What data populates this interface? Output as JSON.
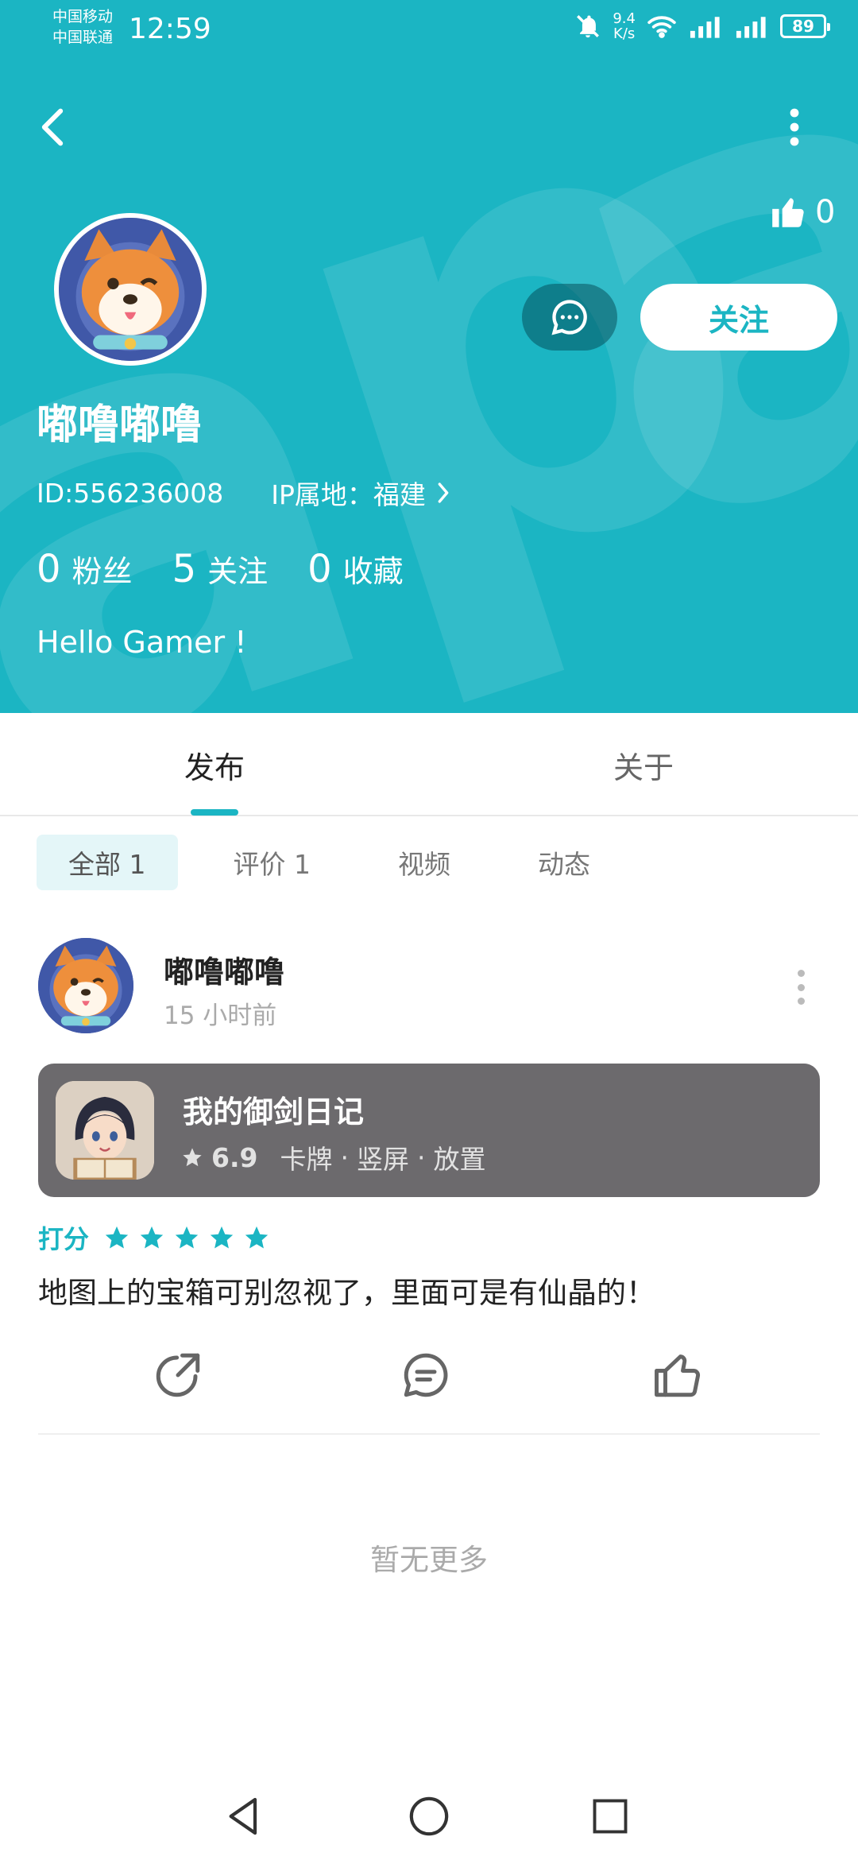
{
  "status_bar": {
    "carrier1": "中国移动",
    "carrier2": "中国联通",
    "time": "12:59",
    "net_speed_value": "9.4",
    "net_speed_unit": "K/s",
    "battery": "89"
  },
  "header": {
    "likes_count": "0",
    "follow_label": "关注",
    "username": "嘟噜嘟噜",
    "user_id": "ID:556236008",
    "ip_location": "IP属地：福建",
    "stats": [
      {
        "num": "0",
        "label": "粉丝"
      },
      {
        "num": "5",
        "label": "关注"
      },
      {
        "num": "0",
        "label": "收藏"
      }
    ],
    "bio": "Hello Gamer !"
  },
  "tabs": [
    {
      "label": "发布"
    },
    {
      "label": "关于"
    }
  ],
  "filters": [
    {
      "label": "全部 1"
    },
    {
      "label": "评价 1"
    },
    {
      "label": "视频"
    },
    {
      "label": "动态"
    }
  ],
  "post": {
    "author": "嘟噜嘟噜",
    "time": "15 小时前",
    "game": {
      "name": "我的御剑日记",
      "score": "6.9",
      "tags": [
        "卡牌",
        "竖屏",
        "放置"
      ]
    },
    "rating_label": "打分",
    "rating_stars": 5,
    "content": "地图上的宝箱可别忽视了，里面可是有仙晶的！"
  },
  "footer": {
    "no_more": "暂无更多"
  },
  "colors": {
    "accent": "#1bb5c3",
    "header_bg": "#1bb5c3",
    "card_bg": "#6c6a6d"
  },
  "icons": {
    "back": "chevron-left-icon",
    "more": "more-vertical-icon",
    "like": "thumbs-up-icon",
    "message": "chat-bubble-icon",
    "share": "share-icon",
    "comment": "comment-icon",
    "star": "star-icon"
  }
}
